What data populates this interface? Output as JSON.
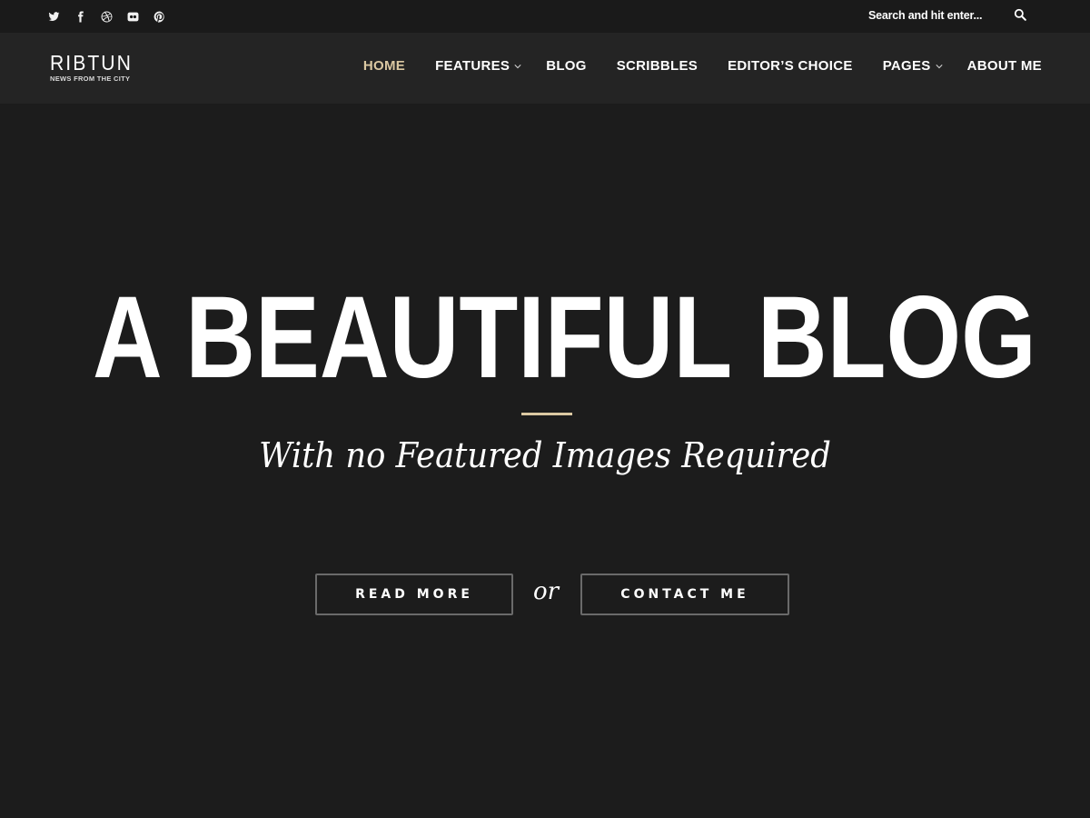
{
  "topbar": {
    "social_icons": [
      "twitter-icon",
      "facebook-icon",
      "dribbble-icon",
      "flickr-icon",
      "pinterest-icon"
    ],
    "search": {
      "placeholder": "Search and hit enter...",
      "value": "",
      "icon": "search-icon"
    }
  },
  "header": {
    "logo": {
      "title": "RIBTUN",
      "tagline": "NEWS FROM THE CITY"
    },
    "menu": [
      {
        "label": "HOME",
        "active": true,
        "has_submenu": false
      },
      {
        "label": "FEATURES",
        "active": false,
        "has_submenu": true
      },
      {
        "label": "BLOG",
        "active": false,
        "has_submenu": false
      },
      {
        "label": "SCRIBBLES",
        "active": false,
        "has_submenu": false
      },
      {
        "label": "EDITOR’S CHOICE",
        "active": false,
        "has_submenu": false
      },
      {
        "label": "PAGES",
        "active": false,
        "has_submenu": true
      },
      {
        "label": "ABOUT ME",
        "active": false,
        "has_submenu": false
      }
    ]
  },
  "hero": {
    "title": "A BEAUTIFUL BLOG",
    "subtitle": "With no Featured Images Required",
    "primary_button": "READ MORE",
    "separator": "or",
    "secondary_button": "CONTACT ME"
  },
  "colors": {
    "background": "#1c1c1c",
    "topbar": "#1a1a1a",
    "navbar": "#242424",
    "accent": "#dbc8a2",
    "text": "#ffffff",
    "button_border": "#6a6a6a"
  }
}
